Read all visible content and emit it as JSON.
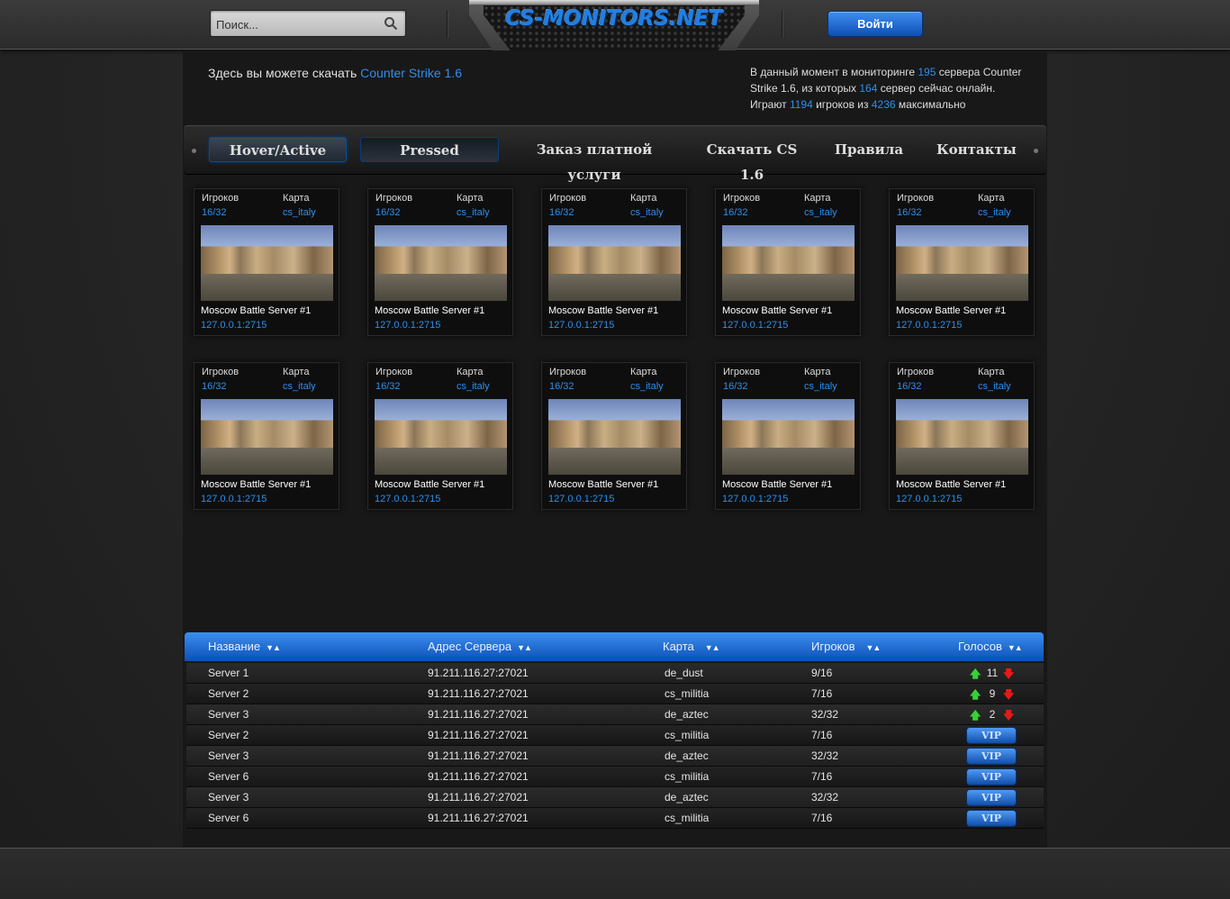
{
  "header": {
    "search_placeholder": "Поиск...",
    "logo": "CS-MONITORS.NET",
    "login_label": "Войти"
  },
  "intro": {
    "text": "Здесь вы можете скачать",
    "link": "Counter Strike 1.6"
  },
  "stats": {
    "p1": "В данный момент в мониторинге",
    "servers_total": "195",
    "p2": "сервера Counter Strike 1.6, из которых",
    "servers_online": "164",
    "p3": "сервер сейчас онлайн.",
    "p4": "Играют",
    "players": "1194",
    "p5": "игроков из",
    "players_max": "4236",
    "p6": "максимально"
  },
  "nav": {
    "items": [
      {
        "label": "Hover/Active"
      },
      {
        "label": "Pressed"
      },
      {
        "label": "Заказ платной услуги"
      },
      {
        "label": "Скачать CS 1.6"
      },
      {
        "label": "Правила"
      },
      {
        "label": "Контакты"
      }
    ]
  },
  "cards": {
    "players_label": "Игроков",
    "map_label": "Карта",
    "items": [
      {
        "players": "16/32",
        "map": "cs_italy",
        "name": "Moscow Battle Server #1",
        "addr": "127.0.0.1:2715"
      },
      {
        "players": "16/32",
        "map": "cs_italy",
        "name": "Moscow Battle Server #1",
        "addr": "127.0.0.1:2715"
      },
      {
        "players": "16/32",
        "map": "cs_italy",
        "name": "Moscow Battle Server #1",
        "addr": "127.0.0.1:2715"
      },
      {
        "players": "16/32",
        "map": "cs_italy",
        "name": "Moscow Battle Server #1",
        "addr": "127.0.0.1:2715"
      },
      {
        "players": "16/32",
        "map": "cs_italy",
        "name": "Moscow Battle Server #1",
        "addr": "127.0.0.1:2715"
      },
      {
        "players": "16/32",
        "map": "cs_italy",
        "name": "Moscow Battle Server #1",
        "addr": "127.0.0.1:2715"
      },
      {
        "players": "16/32",
        "map": "cs_italy",
        "name": "Moscow Battle Server #1",
        "addr": "127.0.0.1:2715"
      },
      {
        "players": "16/32",
        "map": "cs_italy",
        "name": "Moscow Battle Server #1",
        "addr": "127.0.0.1:2715"
      },
      {
        "players": "16/32",
        "map": "cs_italy",
        "name": "Moscow Battle Server #1",
        "addr": "127.0.0.1:2715"
      },
      {
        "players": "16/32",
        "map": "cs_italy",
        "name": "Moscow Battle Server #1",
        "addr": "127.0.0.1:2715"
      }
    ]
  },
  "table": {
    "columns": [
      "Название",
      "Адрес Сервера",
      "Карта",
      "Игроков",
      "Голосов"
    ],
    "sort_icon": "▼▲",
    "vote_up_icon": "🡅",
    "vote_down_icon": "🡇",
    "vip_label": "VIP",
    "rows": [
      {
        "name": "Server 1",
        "addr": "91.211.116.27:27021",
        "map": "de_dust",
        "players": "9/16",
        "votes": "11",
        "vip": false
      },
      {
        "name": "Server 2",
        "addr": "91.211.116.27:27021",
        "map": "cs_militia",
        "players": "7/16",
        "votes": "9",
        "vip": false
      },
      {
        "name": "Server 3",
        "addr": "91.211.116.27:27021",
        "map": "de_aztec",
        "players": "32/32",
        "votes": "2",
        "vip": false
      },
      {
        "name": "Server 2",
        "addr": "91.211.116.27:27021",
        "map": "cs_militia",
        "players": "7/16",
        "votes": "",
        "vip": true
      },
      {
        "name": "Server 3",
        "addr": "91.211.116.27:27021",
        "map": "de_aztec",
        "players": "32/32",
        "votes": "",
        "vip": true
      },
      {
        "name": "Server 6",
        "addr": "91.211.116.27:27021",
        "map": "cs_militia",
        "players": "7/16",
        "votes": "",
        "vip": true
      },
      {
        "name": "Server 3",
        "addr": "91.211.116.27:27021",
        "map": "de_aztec",
        "players": "32/32",
        "votes": "",
        "vip": true
      },
      {
        "name": "Server 6",
        "addr": "91.211.116.27:27021",
        "map": "cs_militia",
        "players": "7/16",
        "votes": "",
        "vip": true
      }
    ]
  },
  "colors": {
    "accent": "#2f8eea",
    "vote_up": "#35d234",
    "vote_down": "#e31b1b"
  }
}
